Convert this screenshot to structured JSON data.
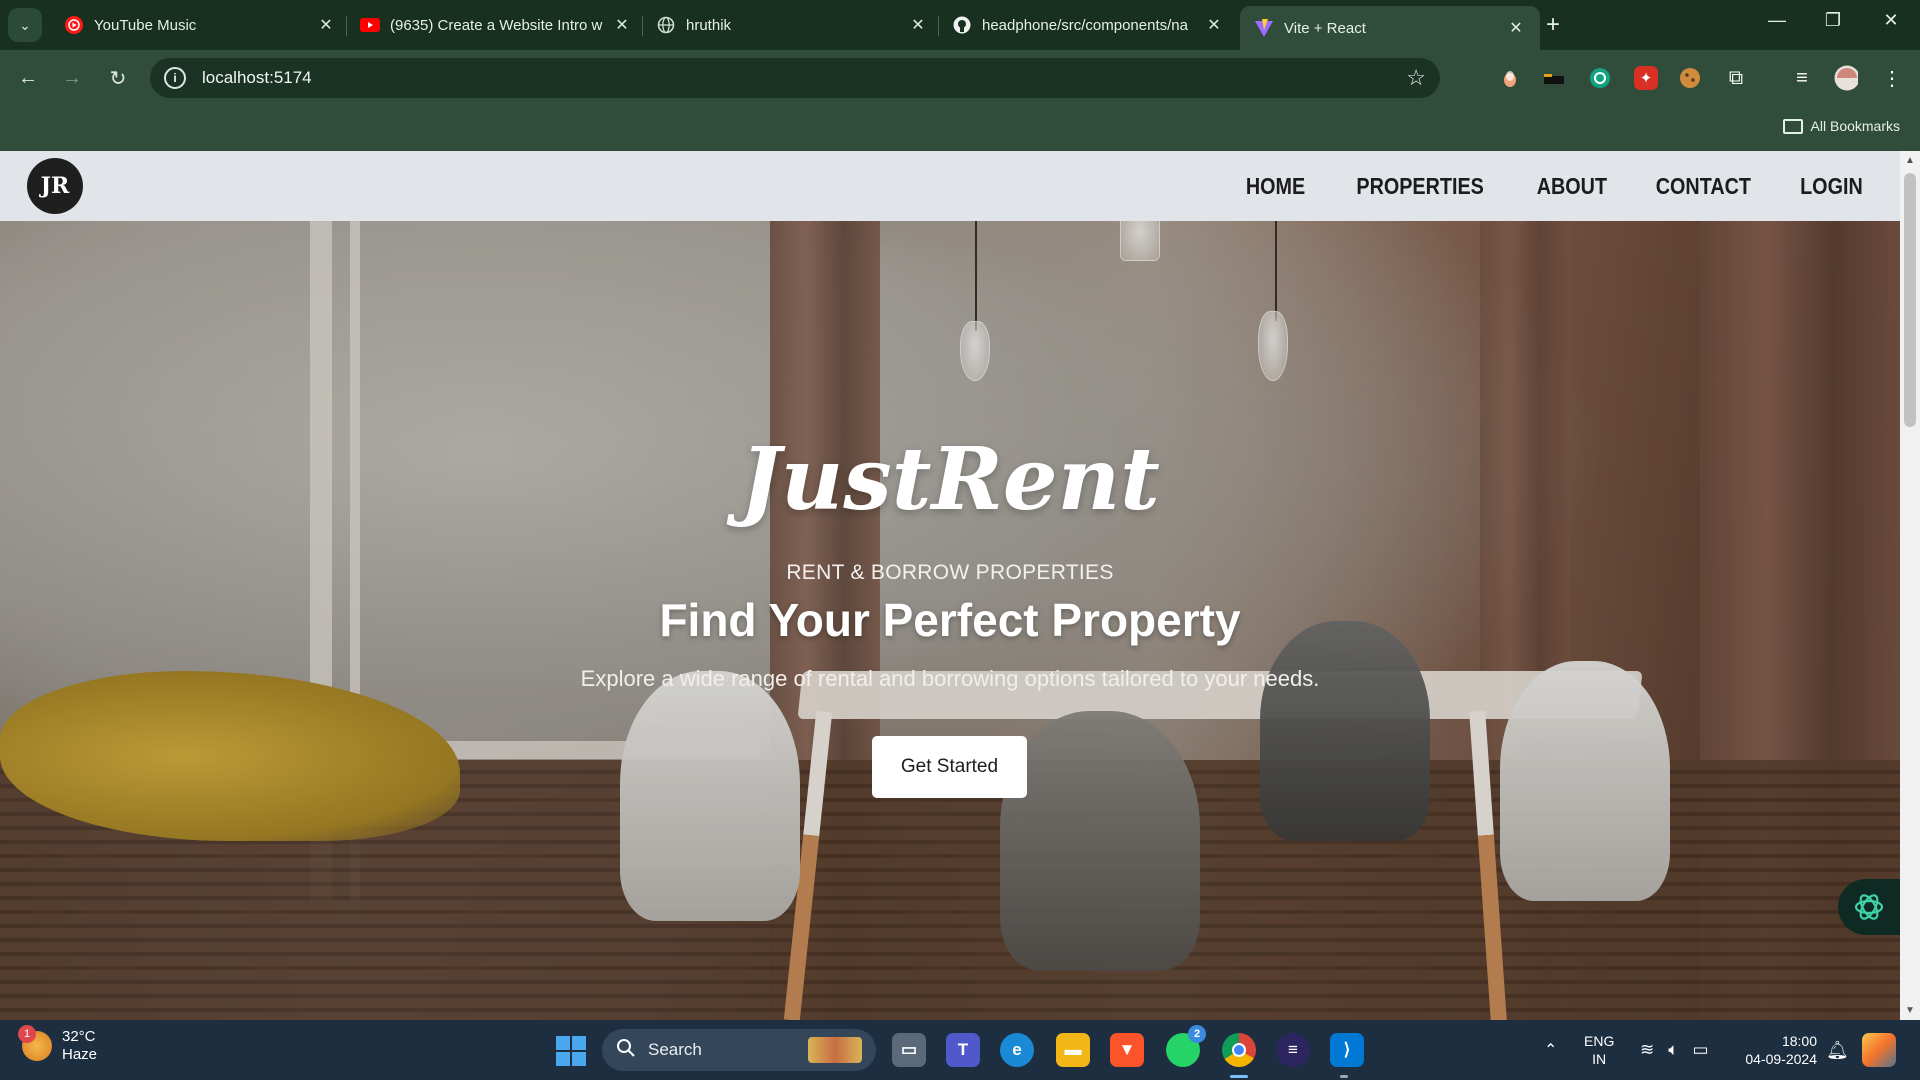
{
  "browser": {
    "tabs": [
      {
        "title": "YouTube Music",
        "favicon": "youtube-music-icon"
      },
      {
        "title": "(9635) Create a Website Intro w",
        "favicon": "youtube-icon"
      },
      {
        "title": "hruthik",
        "favicon": "globe-icon"
      },
      {
        "title": "headphone/src/components/na",
        "favicon": "github-icon"
      },
      {
        "title": "Vite + React",
        "favicon": "vite-icon"
      }
    ],
    "url": "localhost:5174",
    "all_bookmarks": "All Bookmarks"
  },
  "site": {
    "logo_text": "JR",
    "nav": [
      "HOME",
      "PROPERTIES",
      "ABOUT",
      "CONTACT",
      "LOGIN"
    ],
    "brand": "JustRent",
    "tagline": "RENT & BORROW PROPERTIES",
    "headline": "Find Your Perfect Property",
    "subline": "Explore a wide range of rental and borrowing options tailored to your needs.",
    "cta": "Get Started"
  },
  "taskbar": {
    "weather_badge": "1",
    "temperature": "32°C",
    "condition": "Haze",
    "search_label": "Search",
    "whatsapp_badge": "2",
    "lang_top": "ENG",
    "lang_bottom": "IN",
    "time": "18:00",
    "date": "04-09-2024"
  },
  "colors": {
    "chrome_dark": "#17301f",
    "chrome_toolbar": "#2f4d3a",
    "nav_bg": "#e1e5ea",
    "taskbar": "#1c2e40"
  }
}
